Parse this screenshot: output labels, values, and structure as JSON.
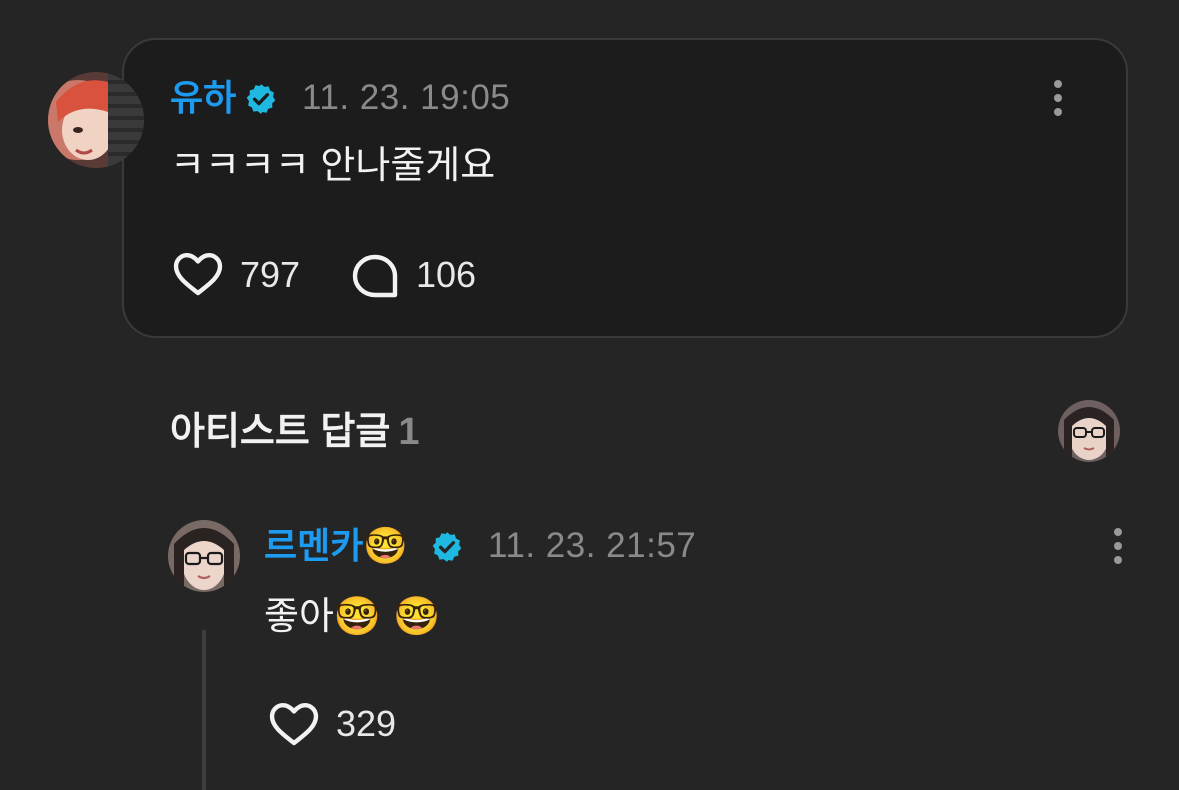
{
  "comment": {
    "author": "유하",
    "timestamp": "11. 23. 19:05",
    "text": "ㅋㅋㅋㅋ 안나줄게요",
    "likes": "797",
    "replies": "106"
  },
  "section": {
    "title": "아티스트 답글",
    "count": "1"
  },
  "reply": {
    "author": "르멘카",
    "author_emoji": "🤓",
    "timestamp": "11. 23. 21:57",
    "text": "좋아",
    "text_emojis": "🤓 🤓",
    "likes": "329"
  },
  "colors": {
    "background": "#252525",
    "card": "#1c1c1c",
    "name": "#1d9bf0",
    "verified_badge": "#1fb8e0",
    "muted": "#8a8a8a"
  },
  "icons": [
    "verified-badge-icon",
    "more-options-icon",
    "heart-icon",
    "comment-bubble-icon"
  ]
}
